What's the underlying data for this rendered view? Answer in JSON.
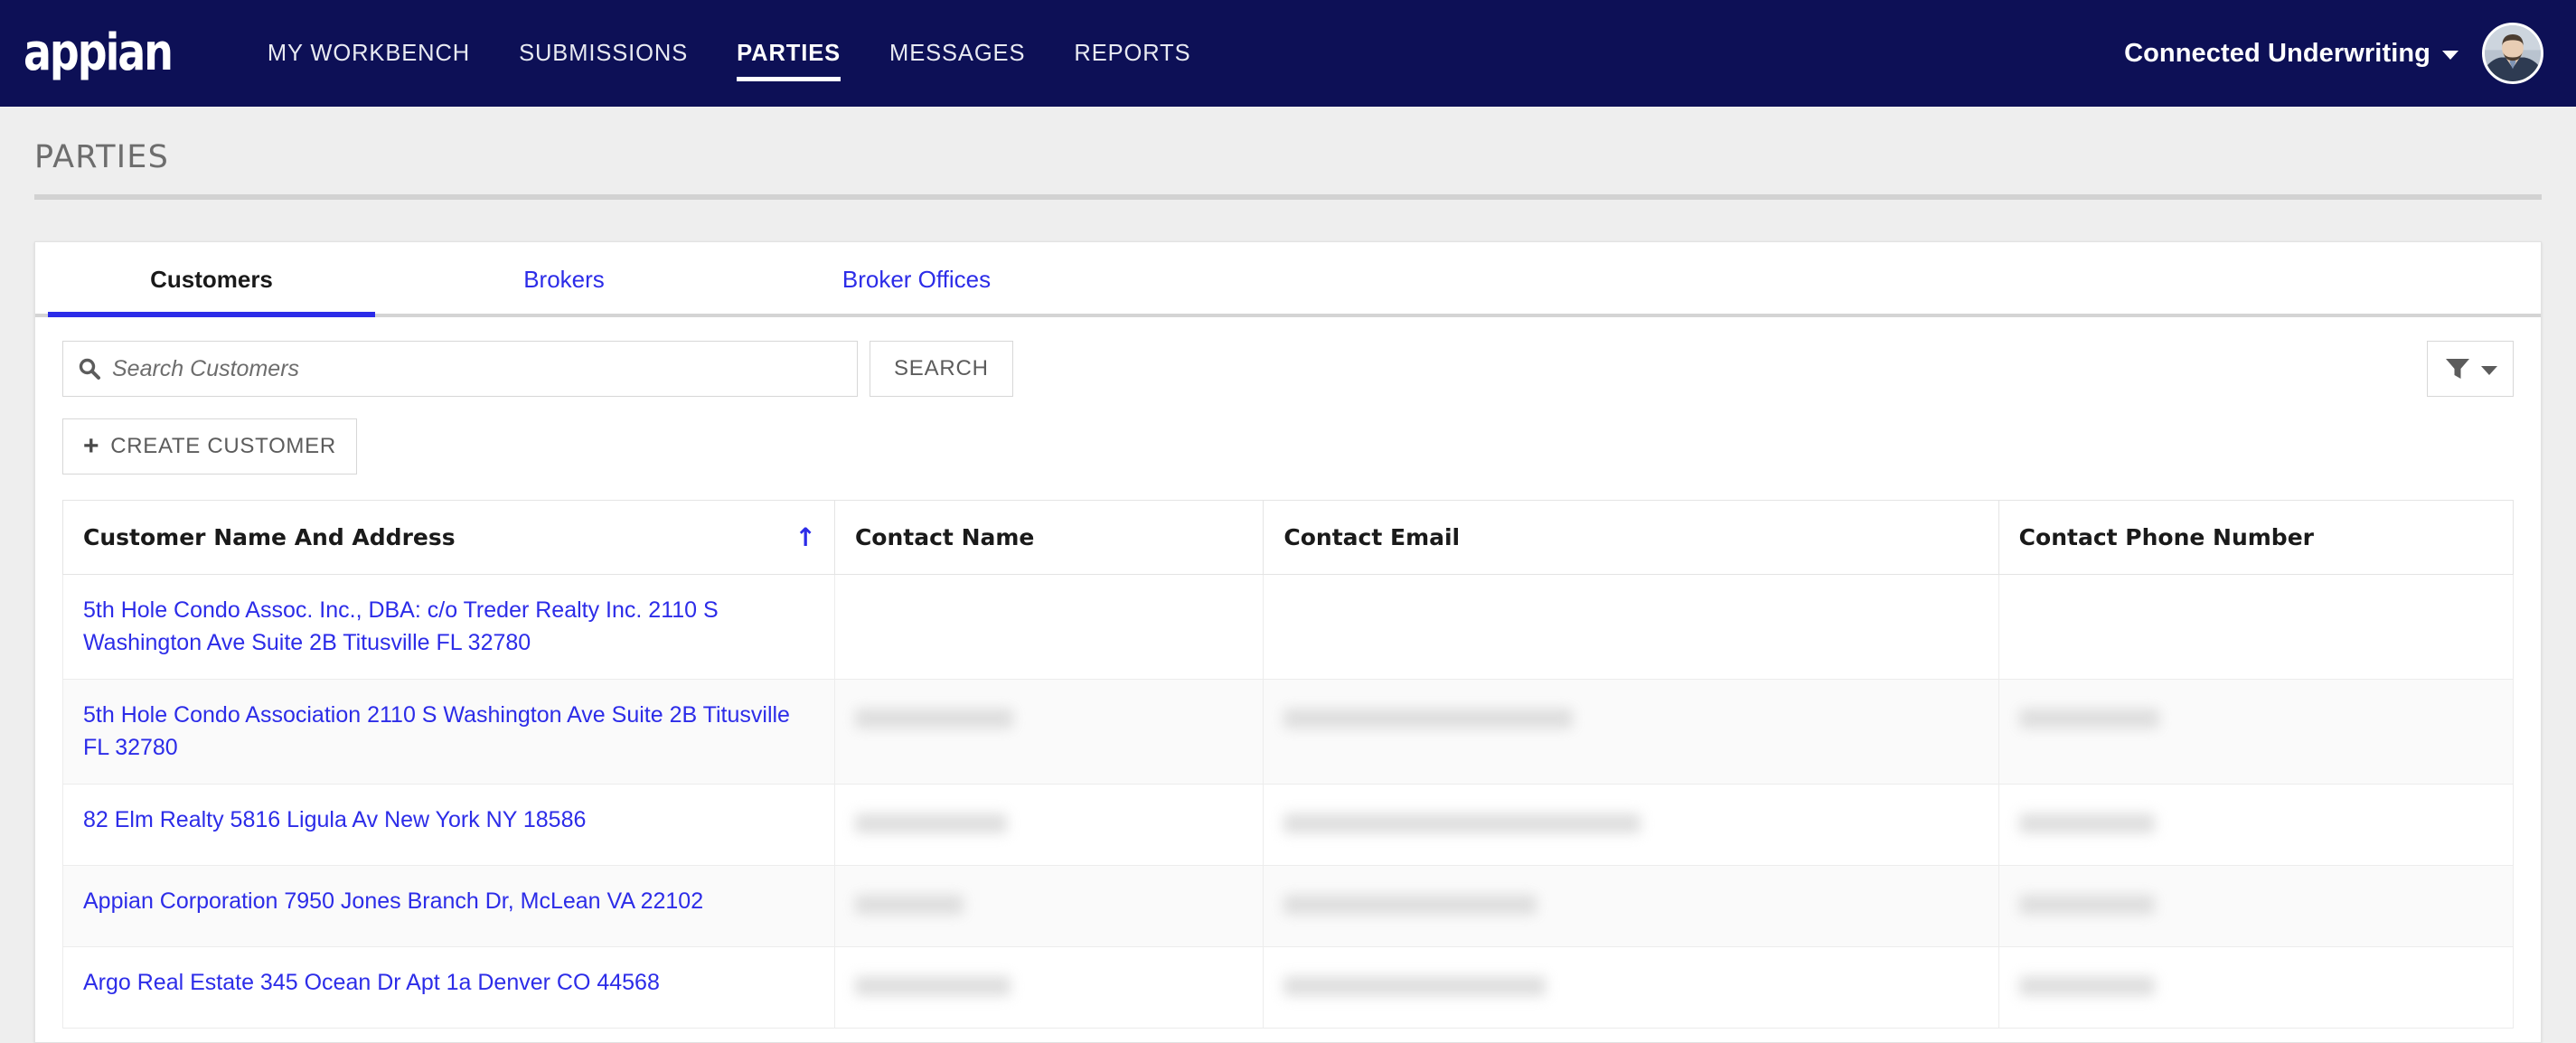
{
  "brand": {
    "logo_text": "appian"
  },
  "nav": {
    "items": [
      {
        "label": "MY WORKBENCH",
        "active": false
      },
      {
        "label": "SUBMISSIONS",
        "active": false
      },
      {
        "label": "PARTIES",
        "active": true
      },
      {
        "label": "MESSAGES",
        "active": false
      },
      {
        "label": "REPORTS",
        "active": false
      }
    ]
  },
  "user": {
    "name": "Connected Underwriting",
    "caret_icon": "chevron-down-icon",
    "avatar_icon": "user-avatar"
  },
  "page": {
    "title": "PARTIES"
  },
  "tabs": [
    {
      "label": "Customers",
      "active": true
    },
    {
      "label": "Brokers",
      "active": false
    },
    {
      "label": "Broker Offices",
      "active": false
    }
  ],
  "toolbar": {
    "search_placeholder": "Search Customers",
    "search_value": "",
    "search_icon": "search-icon",
    "search_button_label": "SEARCH",
    "filter_icon": "funnel-icon",
    "filter_caret_icon": "chevron-down-icon",
    "create_button_label": "CREATE CUSTOMER",
    "create_button_icon": "plus-icon"
  },
  "table": {
    "sort_column": "Customer Name And Address",
    "sort_direction": "ascending",
    "sort_icon": "arrow-up-icon",
    "columns": [
      "Customer Name And Address",
      "Contact Name",
      "Contact Email",
      "Contact Phone Number"
    ],
    "rows": [
      {
        "name_address": "5th Hole Condo Assoc. Inc., DBA: c/o Treder Realty Inc. 2110 S Washington Ave Suite 2B Titusville FL 32780",
        "contact_name": "",
        "contact_email": "",
        "contact_phone": "",
        "redacted": false
      },
      {
        "name_address": "5th Hole Condo Association 2110 S Washington Ave Suite 2B Titusville FL 32780",
        "contact_name": "",
        "contact_email": "",
        "contact_phone": "",
        "redacted": true
      },
      {
        "name_address": "82 Elm Realty 5816 Ligula Av New York NY 18586",
        "contact_name": "",
        "contact_email": "",
        "contact_phone": "",
        "redacted": true
      },
      {
        "name_address": "Appian Corporation 7950 Jones Branch Dr, McLean VA 22102",
        "contact_name": "",
        "contact_email": "",
        "contact_phone": "",
        "redacted": true
      },
      {
        "name_address": "Argo Real Estate 345 Ocean Dr Apt 1a Denver CO 44568",
        "contact_name": "",
        "contact_email": "",
        "contact_phone": "",
        "redacted": true
      }
    ]
  },
  "colors": {
    "nav_navy": "#0d1056",
    "link_blue": "#2c2ce8",
    "page_bg": "#eeeeee",
    "title_gray": "#6d6d6d"
  }
}
